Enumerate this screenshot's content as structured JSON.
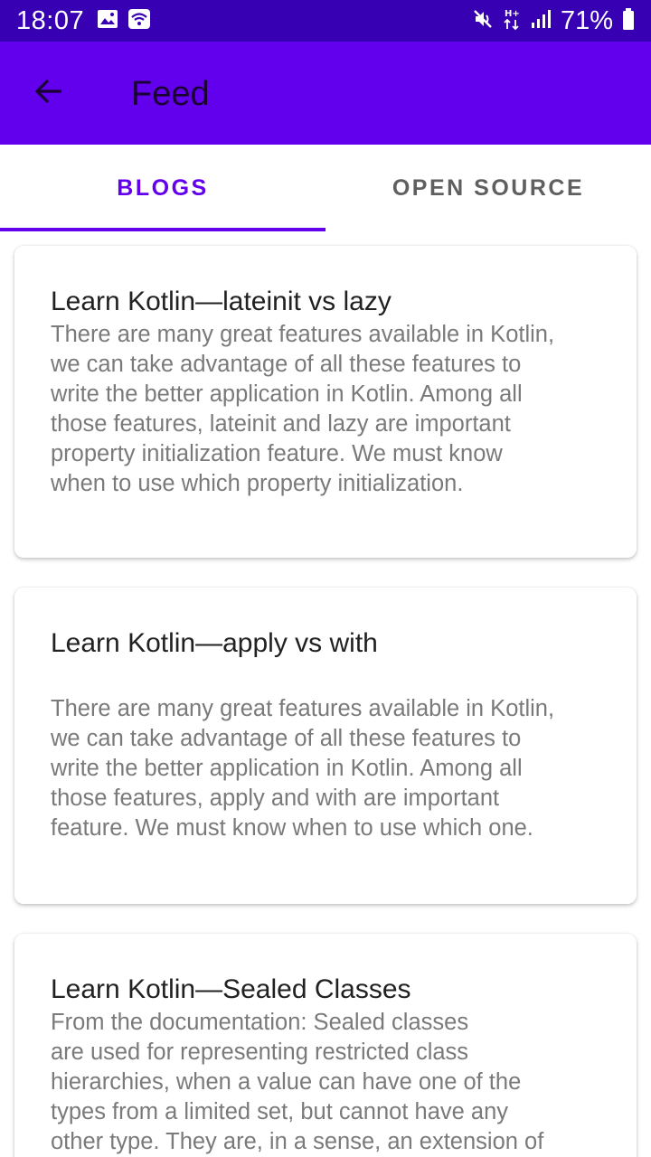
{
  "status_bar": {
    "time": "18:07",
    "battery_percent": "71%",
    "icons": [
      "image-icon",
      "wifi-icon",
      "mute-icon",
      "data-transfer-icon",
      "signal-icon",
      "battery-icon"
    ]
  },
  "app_bar": {
    "title": "Feed",
    "back_icon": "arrow-back-icon"
  },
  "tabs": [
    {
      "label": "BLOGS",
      "selected": true
    },
    {
      "label": "OPEN SOURCE",
      "selected": false
    }
  ],
  "posts": [
    {
      "title": "Learn Kotlin—lateinit vs lazy",
      "body": "There are many great features available in Kotlin,\nwe can take advantage of all these features to\nwrite the better application in Kotlin. Among all\nthose features, lateinit and lazy are important\nproperty initialization feature. We must know\nwhen to use which property initialization."
    },
    {
      "title": "Learn Kotlin—apply vs with",
      "body": "There are many great features available in Kotlin,\nwe can take advantage of all these features to\nwrite the better application in Kotlin. Among all\nthose features, apply and with are important\nfeature. We must know when to use which one."
    },
    {
      "title": "Learn Kotlin—Sealed Classes",
      "body": "From the documentation: Sealed classes\nare used for representing restricted class\nhierarchies, when a value can have one of the\ntypes from a limited set, but cannot have any\nother type. They are, in a sense, an extension of"
    }
  ],
  "colors": {
    "status_bar": "#3700b3",
    "primary": "#6200ee",
    "title_text": "#212121",
    "body_text": "#7a7a7a",
    "inactive_tab": "#5f5f5f"
  }
}
